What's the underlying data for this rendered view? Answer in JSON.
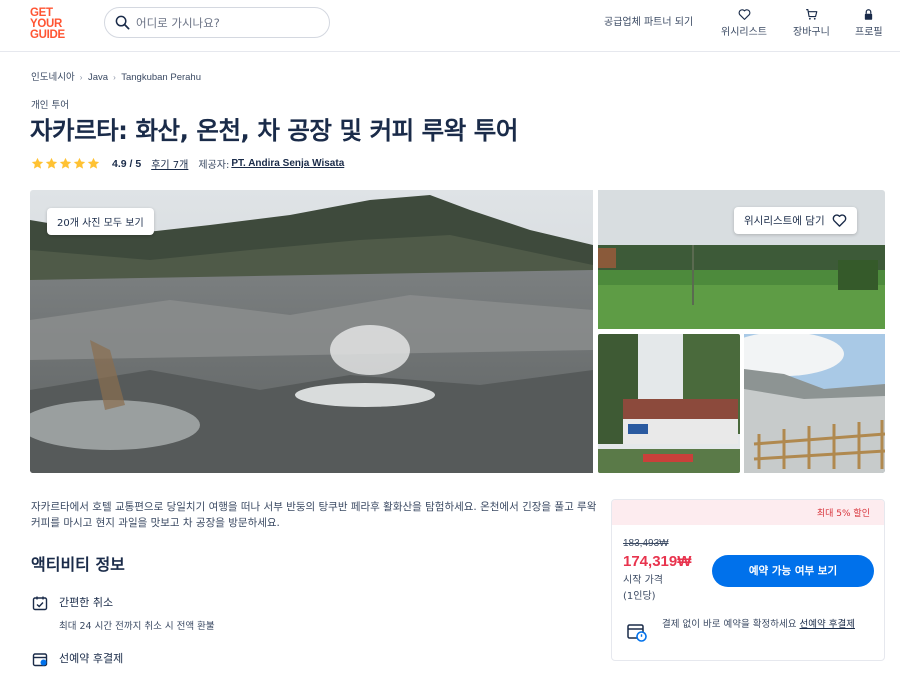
{
  "header": {
    "logo_lines": [
      "GET",
      "YOUR",
      "GUIDE"
    ],
    "search_placeholder": "어디로 가시나요?",
    "partner_link": "공급업체 파트너 되기",
    "nav": [
      {
        "label": "위시리스트",
        "icon": "heart-icon"
      },
      {
        "label": "장바구니",
        "icon": "cart-icon"
      },
      {
        "label": "프로필",
        "icon": "profile-icon"
      }
    ]
  },
  "breadcrumb": [
    "인도네시아",
    "Java",
    "Tangkuban Perahu"
  ],
  "tour_type": "개인 투어",
  "title": "자카르타: 화산, 온천, 차 공장 및 커피 루왁 투어",
  "rating": {
    "stars": 5,
    "score": "4.9 / 5",
    "reviews": "후기 7개",
    "provider_label": "제공자:",
    "provider": "PT. Andira Senja Wisata"
  },
  "gallery": {
    "all_photos_button": "20개 사진 모두 보기",
    "wishlist_button": "위시리스트에 담기"
  },
  "description": "자카르타에서 호텔 교통편으로 당일치기 여행을 떠나 서부 반둥의 탕쿠반 페라후 활화산을 탐험하세요. 온천에서 긴장을 풀고 루왁 커피를 마시고 현지 과일을 맛보고 차 공장을 방문하세요.",
  "activity_info": {
    "title": "액티비티 정보",
    "items": [
      {
        "title": "간편한 취소",
        "subtitle": "최대 24 시간 전까지 취소 시 전액 환불",
        "icon": "calendar-check-icon"
      },
      {
        "title": "선예약 후결제",
        "subtitle": "",
        "icon": "calendar-pay-icon"
      }
    ]
  },
  "booking": {
    "discount": "최대 5% 할인",
    "old_price": "183,493₩",
    "new_price": "174,319₩",
    "price_label": "시작 가격",
    "per_person": "(1인당)",
    "check_button": "예약 가능 여부 보기",
    "reserve_text": "결제 없이 바로 예약을 확정하세요",
    "reserve_link": "선예약 후결제",
    "colors": {
      "accent": "#0071eb",
      "price": "#e8344e",
      "brand": "#ff5533",
      "star": "#ffc233"
    }
  }
}
